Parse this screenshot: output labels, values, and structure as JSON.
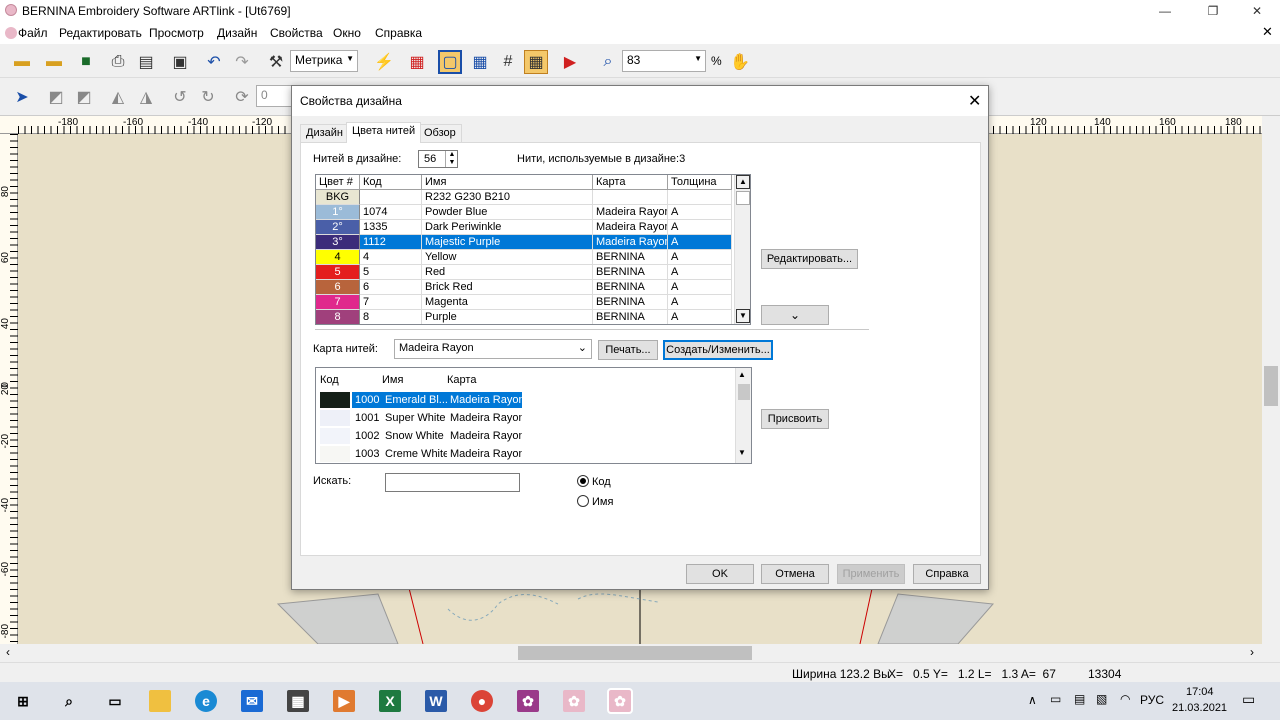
{
  "app": {
    "title": "BERNINA Embroidery Software ARTlink - [Ut6769]"
  },
  "window_buttons": {
    "minimize": "—",
    "restore": "❐",
    "close": "✕"
  },
  "menu": [
    "Файл",
    "Редактировать",
    "Просмотр",
    "Дизайн",
    "Свойства",
    "Окно",
    "Справка"
  ],
  "toolbar": {
    "units": "Метрика",
    "zoom": "83",
    "zoom_unit": "%",
    "field2": "0"
  },
  "ruler_h": [
    "-180",
    "-160",
    "-140",
    "-120",
    "120",
    "140",
    "160",
    "180"
  ],
  "ruler_v": [
    "80",
    "60",
    "40",
    "20",
    "0",
    "-20",
    "-40",
    "-60",
    "-80"
  ],
  "dialog": {
    "title": "Свойства дизайна",
    "close": "✕",
    "tabs": [
      "Дизайн",
      "Цвета нитей",
      "Обзор"
    ],
    "threads_in_design_label": "Нитей в дизайне:",
    "threads_in_design_value": "56",
    "threads_used": "Нити, используемые в дизайне:3",
    "color_table": {
      "headers": [
        "Цвет #",
        "Код",
        "Имя",
        "Карта",
        "Толщина"
      ],
      "rows": [
        {
          "num": "BKG",
          "code": "",
          "name": "R232 G230 B210",
          "chart": "",
          "thickness": "",
          "color": "#e8e6d2",
          "text": "#000"
        },
        {
          "num": "1°",
          "code": "1074",
          "name": "Powder Blue",
          "chart": "Madeira Rayon",
          "thickness": "A",
          "color": "#9bbbd8",
          "text": "#fff"
        },
        {
          "num": "2°",
          "code": "1335",
          "name": "Dark Periwinkle",
          "chart": "Madeira Rayon",
          "thickness": "A",
          "color": "#4a5fa8",
          "text": "#fff"
        },
        {
          "num": "3°",
          "code": "1112",
          "name": "Majestic Purple",
          "chart": "Madeira Rayon",
          "thickness": "A",
          "color": "#3b2c7a",
          "text": "#fff",
          "selected": true
        },
        {
          "num": "4",
          "code": "4",
          "name": "Yellow",
          "chart": "BERNINA",
          "thickness": "A",
          "color": "#ffff00",
          "text": "#000"
        },
        {
          "num": "5",
          "code": "5",
          "name": "Red",
          "chart": "BERNINA",
          "thickness": "A",
          "color": "#e41e1e",
          "text": "#fff"
        },
        {
          "num": "6",
          "code": "6",
          "name": "Brick Red",
          "chart": "BERNINA",
          "thickness": "A",
          "color": "#b8643c",
          "text": "#fff"
        },
        {
          "num": "7",
          "code": "7",
          "name": "Magenta",
          "chart": "BERNINA",
          "thickness": "A",
          "color": "#e0288c",
          "text": "#fff"
        },
        {
          "num": "8",
          "code": "8",
          "name": "Purple",
          "chart": "BERNINA",
          "thickness": "A",
          "color": "#a0407c",
          "text": "#fff"
        }
      ]
    },
    "edit_button": "Редактировать...",
    "chevron_button": "⌄",
    "thread_chart_label": "Карта нитей:",
    "thread_chart_value": "Madeira Rayon",
    "print_button": "Печать...",
    "create_button": "Создать/Изменить...",
    "chart_table": {
      "headers": [
        "Код",
        "Имя",
        "Карта"
      ],
      "rows": [
        {
          "code": "1000",
          "name": "Emerald Bl...",
          "chart": "Madeira Rayon",
          "color": "#152018",
          "selected": true
        },
        {
          "code": "1001",
          "name": "Super White",
          "chart": "Madeira Rayon",
          "color": "#eef0f8"
        },
        {
          "code": "1002",
          "name": "Snow White",
          "chart": "Madeira Rayon",
          "color": "#f2f4fa"
        },
        {
          "code": "1003",
          "name": "Creme White",
          "chart": "Madeira Rayon",
          "color": "#f7f7f4"
        }
      ]
    },
    "assign_button": "Присвоить",
    "search_label": "Искать:",
    "search_value": "",
    "radio_code": "Код",
    "radio_name": "Имя",
    "ok": "OK",
    "cancel": "Отмена",
    "apply": "Применить",
    "help": "Справка"
  },
  "status": {
    "width": "Ширина 123.2 Вы",
    "coords": "X=   0.5 Y=   1.2 L=   1.3 A=  67",
    "count": "13304"
  },
  "taskbar": {
    "lang": "РУС",
    "time": "17:04",
    "date": "21.03.2021"
  }
}
